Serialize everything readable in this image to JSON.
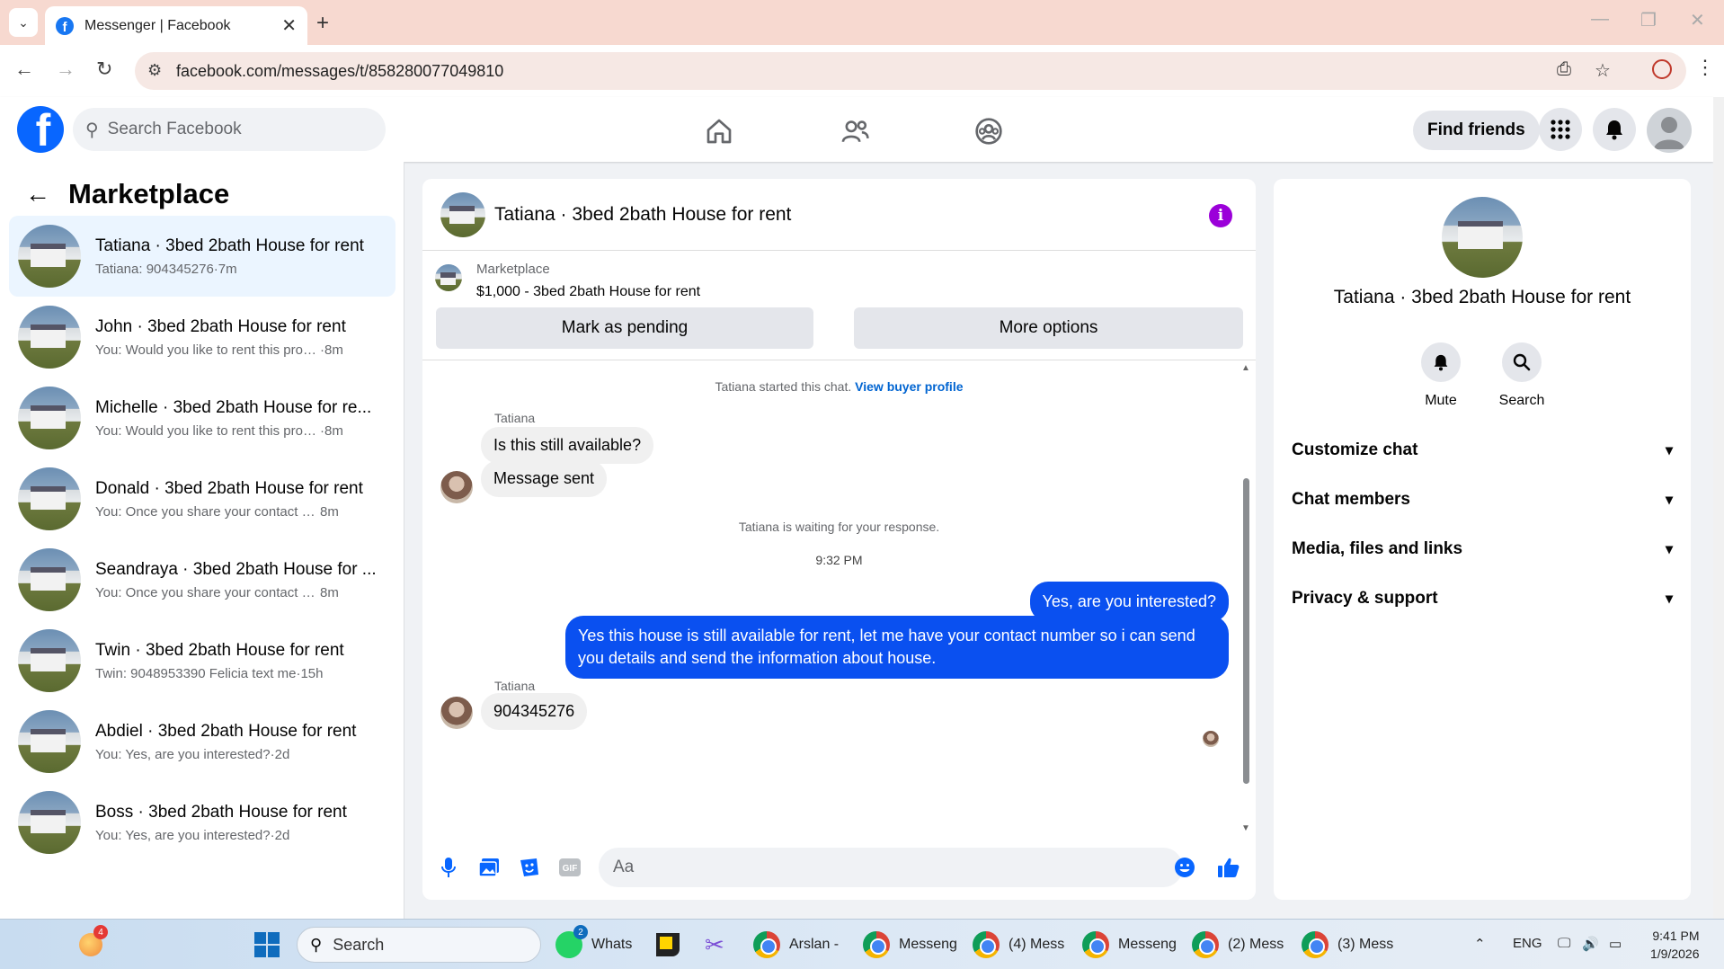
{
  "browser": {
    "tab_title": "Messenger | Facebook",
    "url": "facebook.com/messages/t/858280077049810"
  },
  "fb": {
    "search_placeholder": "Search Facebook",
    "find_friends": "Find friends"
  },
  "sidebar": {
    "title": "Marketplace",
    "conversations": [
      {
        "name": "Tatiana · 3bed 2bath House for rent",
        "snippet": "Tatiana: 904345276",
        "time": "7m",
        "active": true
      },
      {
        "name": "John · 3bed 2bath House for rent",
        "snippet": "You: Would you like to rent this prop...",
        "time": "8m"
      },
      {
        "name": "Michelle · 3bed 2bath House for re...",
        "snippet": "You: Would you like to rent this prop...",
        "time": "8m"
      },
      {
        "name": "Donald · 3bed 2bath House for rent",
        "snippet": "You: Once you share your contact nu...",
        "time": "8m"
      },
      {
        "name": "Seandraya · 3bed 2bath House for ...",
        "snippet": "You: Once you share your contact nu...",
        "time": "8m"
      },
      {
        "name": "Twin · 3bed 2bath House for rent",
        "snippet": "Twin: 9048953390 Felicia text me",
        "time": "15h"
      },
      {
        "name": "Abdiel · 3bed 2bath House for rent",
        "snippet": "You: Yes, are you interested?",
        "time": "2d"
      },
      {
        "name": "Boss · 3bed 2bath House for rent",
        "snippet": "You: Yes, are you interested?",
        "time": "2d"
      }
    ]
  },
  "chat": {
    "title": "Tatiana · 3bed 2bath House for rent",
    "marketplace_label": "Marketplace",
    "listing": "$1,000 - 3bed 2bath House for rent",
    "mark_pending": "Mark as pending",
    "more_options": "More options",
    "started_text": "Tatiana started this chat.",
    "view_profile": "View buyer profile",
    "sender1": "Tatiana",
    "msg1": "Is this still available?",
    "msg2": "Message sent",
    "waiting": "Tatiana is waiting for your response.",
    "time_divider": "9:32 PM",
    "out1": "Yes, are you interested?",
    "out2": "Yes this house is still available for rent, let me have your contact number so i can send you details and send the information about house.",
    "sender2": "Tatiana",
    "msg3": "904345276",
    "input_placeholder": "Aa"
  },
  "info": {
    "title": "Tatiana · 3bed 2bath House for rent",
    "mute": "Mute",
    "search": "Search",
    "sections": [
      "Customize chat",
      "Chat members",
      "Media, files and links",
      "Privacy & support"
    ]
  },
  "taskbar": {
    "search": "Search",
    "apps": [
      {
        "label": "Whats",
        "badge": "2"
      },
      {
        "label": "Arslan - "
      },
      {
        "label": "Messeng"
      },
      {
        "label": "(4) Mess"
      },
      {
        "label": "Messeng"
      },
      {
        "label": "(2) Mess"
      },
      {
        "label": "(3) Mess"
      }
    ],
    "weather_badge": "4",
    "lang": "ENG",
    "time": "9:41 PM",
    "date": "1/9/2026"
  }
}
